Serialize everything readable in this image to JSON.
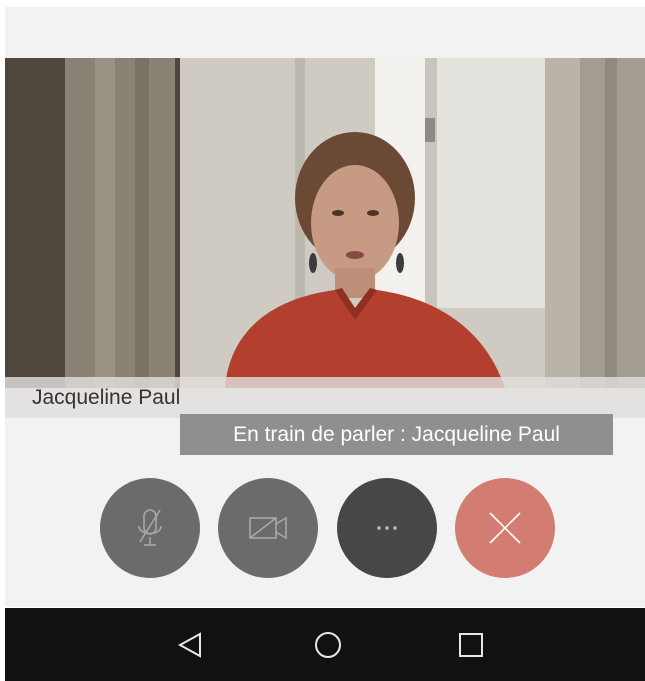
{
  "participant": {
    "name": "Jacqueline Paul"
  },
  "speaker_banner": {
    "text": "En train de parler : Jacqueline Paul"
  },
  "controls": [
    {
      "id": "mute",
      "icon": "mic-off-icon",
      "color": "#6b6b6b"
    },
    {
      "id": "camera",
      "icon": "camera-off-icon",
      "color": "#6b6b6b"
    },
    {
      "id": "more",
      "icon": "more-icon",
      "label": "···",
      "color": "#474747"
    },
    {
      "id": "hangup",
      "icon": "close-icon",
      "color": "#d27c72"
    }
  ],
  "navigation": [
    {
      "id": "back",
      "icon": "back-triangle-icon"
    },
    {
      "id": "home",
      "icon": "home-circle-icon"
    },
    {
      "id": "recents",
      "icon": "recents-square-icon"
    }
  ]
}
